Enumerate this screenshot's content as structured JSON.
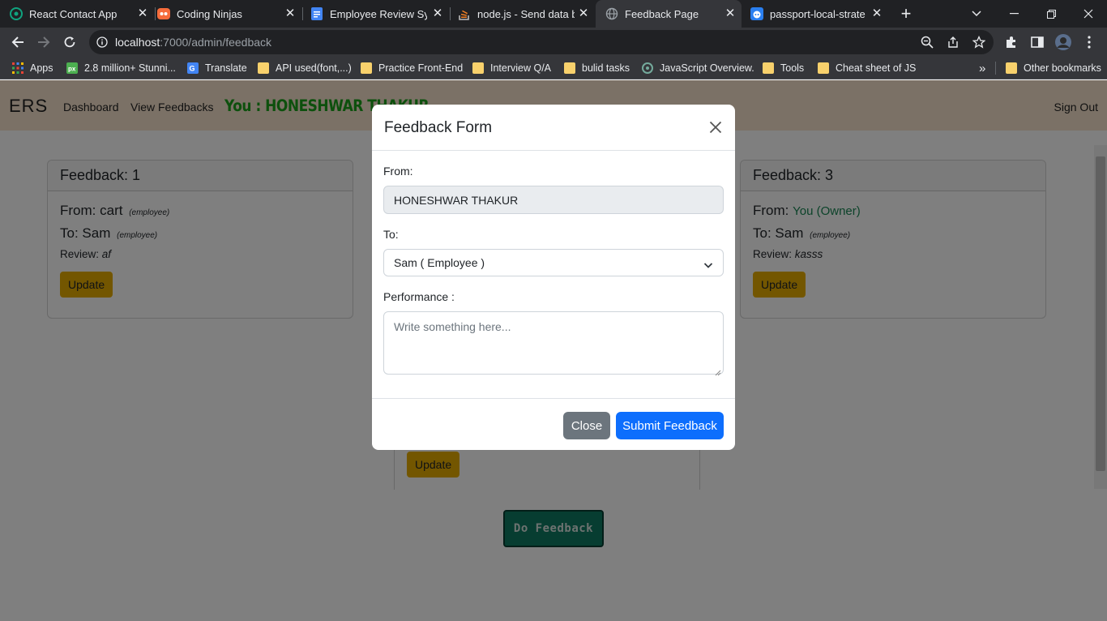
{
  "browser": {
    "tabs": [
      {
        "title": "React Contact App",
        "icon": "openai-icon"
      },
      {
        "title": "Coding Ninjas",
        "icon": "coding-ninjas-icon"
      },
      {
        "title": "Employee Review Syst",
        "icon": "google-docs-icon"
      },
      {
        "title": "node.js - Send data ba",
        "icon": "stackoverflow-icon"
      },
      {
        "title": "Feedback Page",
        "icon": "globe-icon"
      },
      {
        "title": "passport-local-strateg",
        "icon": "github-icon"
      }
    ],
    "url_host": "localhost",
    "url_path": ":7000/admin/feedback",
    "bookmarks": [
      {
        "label": "Apps"
      },
      {
        "label": "2.8 million+ Stunni..."
      },
      {
        "label": "Translate"
      },
      {
        "label": "API used(font,...)"
      },
      {
        "label": "Practice Front-End"
      },
      {
        "label": "Interview Q/A"
      },
      {
        "label": "bulid tasks"
      },
      {
        "label": "JavaScript Overview."
      },
      {
        "label": "Tools"
      },
      {
        "label": "Cheat sheet of JS"
      }
    ],
    "more_bookmarks": "»",
    "other_bookmarks": "Other bookmarks"
  },
  "navbar": {
    "brand": "ERS",
    "links": [
      "Dashboard",
      "View Feedbacks"
    ],
    "you_label": "You :  HONESHWAR THAKUR",
    "sign_out": "Sign Out"
  },
  "cards": [
    {
      "header": "Feedback: 1",
      "from_prefix": "From: ",
      "from_name": "cart",
      "from_role": "(employee)",
      "to_prefix": "To: ",
      "to_name": "Sam",
      "to_role": "(employee)",
      "review_prefix": "Review: ",
      "review": "af",
      "button": "Update"
    },
    {
      "header": "Feedback: 3",
      "from_prefix": "From: ",
      "from_name": "You (Owner)",
      "to_prefix": "To: ",
      "to_name": "Sam",
      "to_role": "(employee)",
      "review_prefix": "Review: ",
      "review": "kasss",
      "button": "Update"
    }
  ],
  "card_middle_button": "Update",
  "do_feedback": "Do Feedback",
  "modal": {
    "title": "Feedback Form",
    "from_label": "From:",
    "from_value": "HONESHWAR THAKUR",
    "to_label": "To:",
    "to_selected": "Sam ( Employee )",
    "performance_label": "Performance :",
    "performance_placeholder": "Write something here...",
    "close_button": "Close",
    "submit_button": "Submit Feedback"
  },
  "colors": {
    "navbar_bg": "#f6e3cd",
    "you_label": "#1aa11a",
    "owner_text": "#198754",
    "update_button": "#e6ac00",
    "do_feedback": "#0e7a63",
    "primary": "#0d6efd",
    "secondary": "#6c757d"
  }
}
